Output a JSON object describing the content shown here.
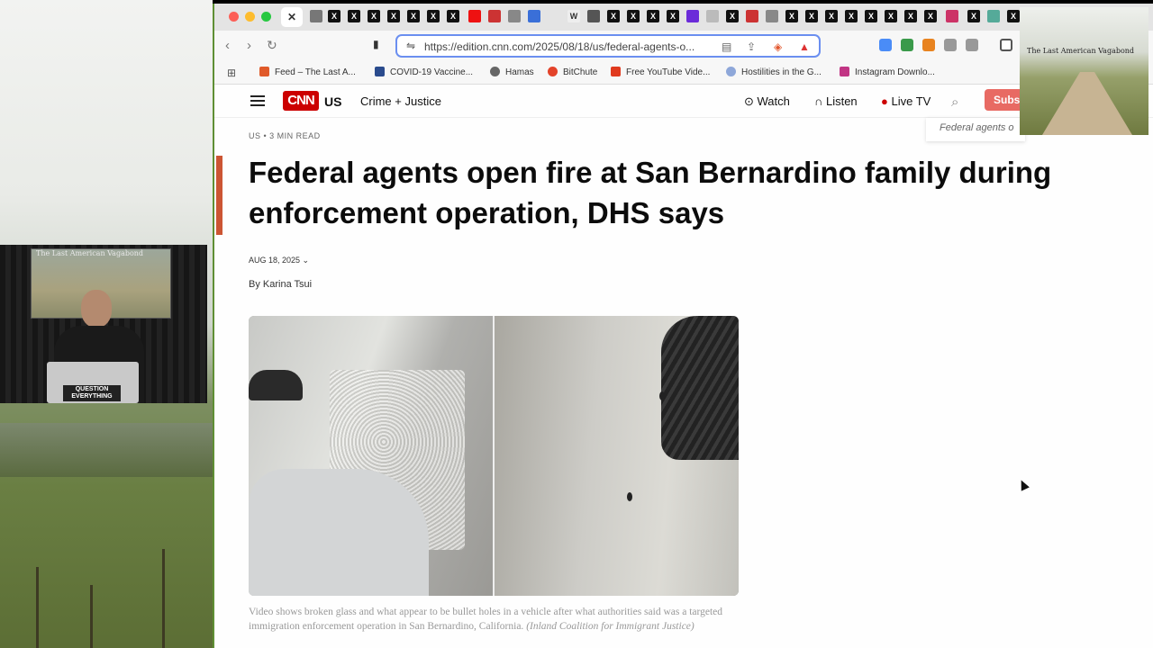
{
  "browser": {
    "url": "https://edition.cnn.com/2025/08/18/us/federal-agents-o...",
    "bookmarks": [
      {
        "label": "Feed – The Last A...",
        "color": "#e05a2a"
      },
      {
        "label": "COVID-19 Vaccine...",
        "color": "#2a4b8d"
      },
      {
        "label": "Hamas",
        "color": "#666666"
      },
      {
        "label": "BitChute",
        "color": "#e3432a"
      },
      {
        "label": "Free YouTube Vide...",
        "color": "#e03a1e"
      },
      {
        "label": "Hostilities in the G...",
        "color": "#8ea7d9"
      },
      {
        "label": "Instagram Downlo...",
        "color": "#c13584"
      }
    ]
  },
  "cnn": {
    "logo": "CNN",
    "section": "US",
    "subsection": "Crime + Justice",
    "watch": "Watch",
    "listen": "Listen",
    "live": "Live TV",
    "subscribe": "Subs",
    "search_hint": "Federal agents o"
  },
  "article": {
    "kicker": "US • 3 MIN READ",
    "headline": "Federal agents open fire at San Bernardino family during enforcement operation, DHS says",
    "date": "AUG 18, 2025",
    "byline": "By Karina Tsui",
    "caption": "Video shows broken glass and what appear to be bullet holes in a vehicle after what authorities said was a targeted immigration enforcement operation in San Bernardino, California.",
    "credit": "(Inland Coalition for Immigrant Justice)"
  },
  "overlay": {
    "cam_title": "The Last American Vagabond",
    "cam_sign": "QUESTION EVERYTHING",
    "thumb_title": "The Last American Vagabond"
  },
  "icons": [
    "back-icon",
    "forward-icon",
    "reload-icon",
    "bookmark-icon",
    "search-icon",
    "headphones-icon",
    "play-circle-icon",
    "close-icon"
  ]
}
